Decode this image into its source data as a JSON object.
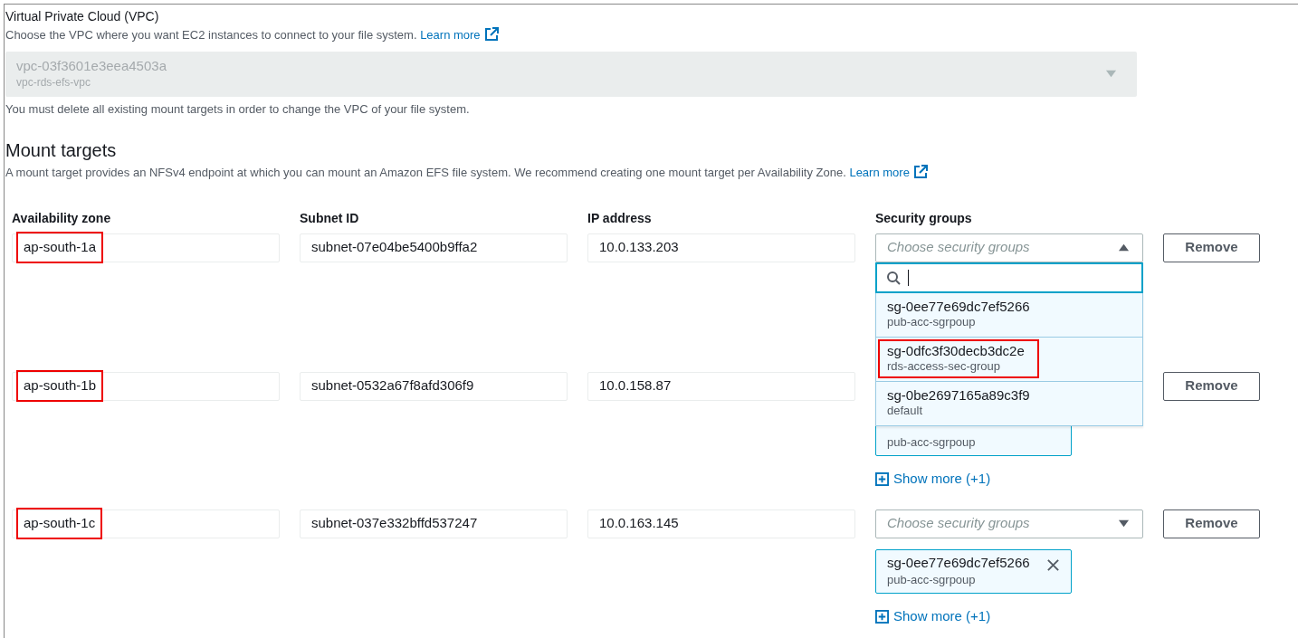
{
  "vpc": {
    "label": "Virtual Private Cloud (VPC)",
    "description": "Choose the VPC where you want EC2 instances to connect to your file system.",
    "learn_more": "Learn more",
    "value": "vpc-03f3601e3eea4503a",
    "subvalue": "vpc-rds-efs-vpc",
    "disabled": true,
    "hint": "You must delete all existing mount targets in order to change the VPC of your file system."
  },
  "mount_targets": {
    "title": "Mount targets",
    "description": "A mount target provides an NFSv4 endpoint at which you can mount an Amazon EFS file system. We recommend creating one mount target per Availability Zone.",
    "learn_more": "Learn more",
    "columns": [
      "Availability zone",
      "Subnet ID",
      "IP address",
      "Security groups"
    ],
    "rows": [
      {
        "zone": "ap-south-1a",
        "marked": true,
        "subnet": "subnet-07e04be5400b9ffa2",
        "ip": "10.0.133.203",
        "select": {
          "placeholder": "Choose security groups",
          "expanded": true
        },
        "remove": "Remove",
        "dropdown": {
          "options": [
            {
              "id": "sg-0ee77e69dc7ef5266",
              "description": "pub-acc-sgrpoup",
              "marked": false
            },
            {
              "id": "sg-0dfc3f30decb3dc2e",
              "description": "rds-access-sec-group",
              "marked": true
            },
            {
              "id": "sg-0be2697165a89c3f9",
              "description": "default",
              "marked": false
            }
          ]
        }
      },
      {
        "zone": "ap-south-1b",
        "marked": true,
        "subnet": "subnet-0532a67f8afd306f9",
        "ip": "10.0.158.87",
        "remove": "Remove",
        "tokens": [
          {
            "description": "pub-acc-sgrpoup"
          }
        ],
        "show_more": "Show more (+1)"
      },
      {
        "zone": "ap-south-1c",
        "marked": true,
        "subnet": "subnet-037e332bffd537247",
        "ip": "10.0.163.145",
        "select": {
          "placeholder": "Choose security groups",
          "expanded": false
        },
        "remove": "Remove",
        "tokens": [
          {
            "id": "sg-0ee77e69dc7ef5266",
            "description": "pub-acc-sgrpoup"
          }
        ],
        "show_more": "Show more (+1)"
      }
    ]
  }
}
